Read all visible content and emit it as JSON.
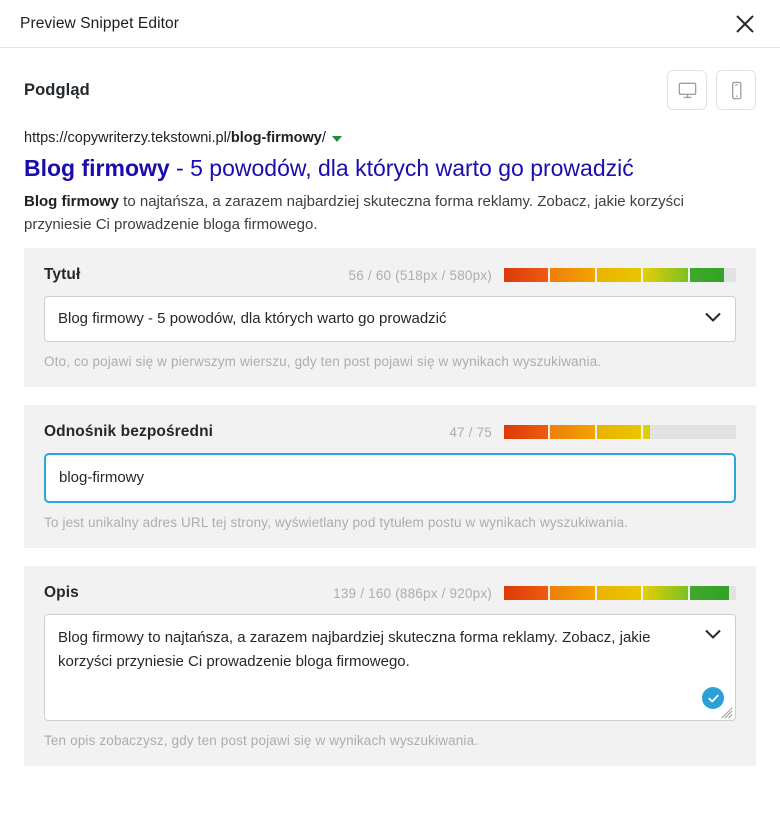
{
  "header": {
    "title": "Preview Snippet Editor",
    "close_label": "×",
    "close_icon": "close-icon"
  },
  "preview": {
    "heading": "Podgląd",
    "devices": [
      {
        "name": "desktop",
        "icon": "desktop-monitor-icon",
        "selected": true
      },
      {
        "name": "mobile",
        "icon": "mobile-phone-icon",
        "selected": false
      }
    ]
  },
  "serp": {
    "url_prefix": "https://copywriterzy.tekstowni.pl/",
    "url_slug": "blog-firmowy",
    "url_suffix": "/",
    "caret_icon": "caret-down-icon",
    "caret_color": "#1e8e3e",
    "title_bold": "Blog firmowy",
    "title_rest": " - 5 powodów, dla których warto go prowadzić",
    "title_color": "#1a0dab",
    "description_bold": "Blog firmowy",
    "description_rest": " to najtańsza, a zarazem najbardziej skuteczna forma reklamy. Zobacz, jakie korzyści przyniesie Ci prowadzenie bloga firmowego."
  },
  "fields": {
    "title": {
      "label": "Tytuł",
      "counter": "56 / 60 (518px / 580px)",
      "meter_fill_percent": 95,
      "value": "Blog firmowy - 5 powodów, dla których warto go prowadzić",
      "placeholder": "",
      "help": "Oto, co pojawi się w pierwszym wierszu, gdy ten post pojawi się w wynikach wyszukiwania.",
      "chevron_icon": "chevron-down-icon",
      "focused": false
    },
    "permalink": {
      "label": "Odnośnik bezpośredni",
      "counter": "47 / 75",
      "meter_fill_percent": 63,
      "value": "blog-firmowy",
      "placeholder": "",
      "help": "To jest unikalny adres URL tej strony, wyświetlany pod tytułem postu w wynikach wyszukiwania.",
      "focused": true,
      "focus_color": "#29a8d8"
    },
    "description": {
      "label": "Opis",
      "counter": "139 / 160 (886px / 920px)",
      "meter_fill_percent": 97,
      "value": "Blog firmowy to najtańsza, a zarazem najbardziej skuteczna forma reklamy. Zobacz, jakie korzyści przyniesie Ci prowadzenie bloga firmowego.",
      "placeholder": "",
      "help": "Ten opis zobaczysz, gdy ten post pojawi się w wynikach wyszukiwania.",
      "chevron_icon": "chevron-down-icon",
      "check_icon": "check-circle-icon",
      "check_color": "#2a9fd8",
      "resize_icon": "resize-grip-icon",
      "focused": false
    }
  },
  "meter_colors": {
    "segment1": "#dd3a0a",
    "segment2": "#f07d0c",
    "segment3": "#ecb100",
    "segment4": "#9bc11e",
    "segment5": "#2fa224",
    "track": "#e2e2e2"
  }
}
